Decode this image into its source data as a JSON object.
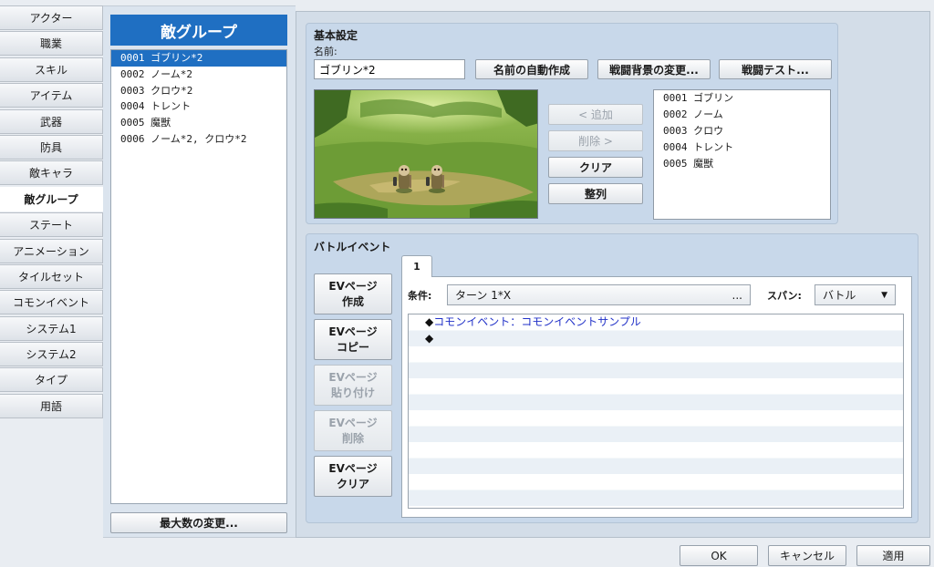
{
  "nav": {
    "items": [
      "アクター",
      "職業",
      "スキル",
      "アイテム",
      "武器",
      "防具",
      "敵キャラ",
      "敵グループ",
      "ステート",
      "アニメーション",
      "タイルセット",
      "コモンイベント",
      "システム1",
      "システム2",
      "タイプ",
      "用語"
    ],
    "active_index": 7
  },
  "groups": {
    "title": "敵グループ",
    "items": [
      "0001 ゴブリン*2",
      "0002 ノーム*2",
      "0003 クロウ*2",
      "0004 トレント",
      "0005 魔獣",
      "0006 ノーム*2, クロウ*2"
    ],
    "selected_index": 0,
    "max_button": "最大数の変更..."
  },
  "basic": {
    "title": "基本設定",
    "name_label": "名前:",
    "name_value": "ゴブリン*2",
    "auto_name_button": "名前の自動作成",
    "bg_button": "戦闘背景の変更...",
    "test_button": "戦闘テスト...",
    "add_button": "< 追加",
    "remove_button": "削除 >",
    "clear_button": "クリア",
    "align_button": "整列",
    "troop_list": [
      "0001 ゴブリン",
      "0002 ノーム",
      "0003 クロウ",
      "0004 トレント",
      "0005 魔獣"
    ]
  },
  "battle": {
    "title": "バトルイベント",
    "ev_create": [
      "EVページ",
      "作成"
    ],
    "ev_copy": [
      "EVページ",
      "コピー"
    ],
    "ev_paste": [
      "EVページ",
      "貼り付け"
    ],
    "ev_delete": [
      "EVページ",
      "削除"
    ],
    "ev_clear": [
      "EVページ",
      "クリア"
    ],
    "tab_label": "1",
    "condition_label": "条件:",
    "condition_value": "ターン 1*X",
    "condition_ellipsis": "...",
    "span_label": "スパン:",
    "span_value": "バトル",
    "commands": [
      {
        "marker": "◆",
        "text": "コモンイベント：コモンイベントサンプル"
      },
      {
        "marker": "◆",
        "text": ""
      }
    ]
  },
  "footer": {
    "ok": "OK",
    "cancel": "キャンセル",
    "apply": "適用"
  },
  "colors": {
    "accent": "#1f6fc2",
    "command_text": "#2232c8"
  }
}
